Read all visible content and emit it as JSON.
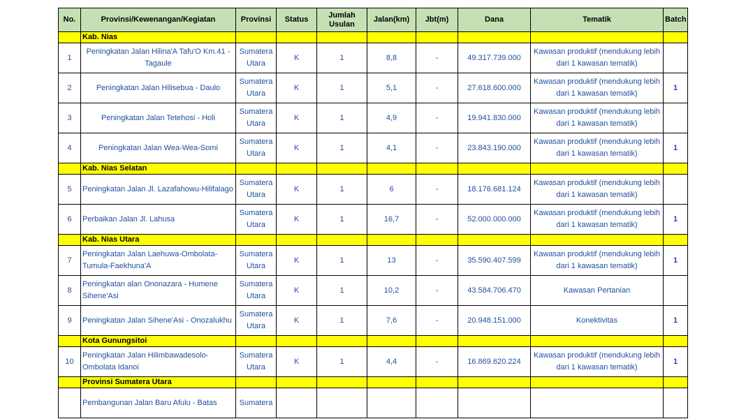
{
  "headers": {
    "no": "No.",
    "kegiatan": "Provinsi/Kewenangan/Kegiatan",
    "provinsi": "Provinsi",
    "status": "Status",
    "jumlah_usulan": "Jumlah Usulan",
    "jalan": "Jalan(km)",
    "jbt": "Jbt(m)",
    "dana": "Dana",
    "tematik": "Tematik",
    "batch": "Batch"
  },
  "groups": [
    {
      "label": "Kab. Nias",
      "rows": [
        {
          "no": "1",
          "kegiatan": "Peningkatan Jalan Hilina'A Tafu'O Km.41 - Tagaule",
          "align": "c",
          "provinsi": "Sumatera Utara",
          "status": "K",
          "usulan": "1",
          "jalan": "8,8",
          "jbt": "-",
          "dana": "49.317.739.000",
          "tematik": "Kawasan produktif (mendukung lebih dari 1 kawasan tematik)",
          "batch": ""
        },
        {
          "no": "2",
          "kegiatan": "Peningkatan Jalan Hilisebua - Daulo",
          "align": "c",
          "provinsi": "Sumatera Utara",
          "status": "K",
          "usulan": "1",
          "jalan": "5,1",
          "jbt": "-",
          "dana": "27.618.600.000",
          "tematik": "Kawasan produktif (mendukung lebih dari 1 kawasan tematik)",
          "batch": "1"
        },
        {
          "no": "3",
          "kegiatan": "Peningkatan Jalan Tetehosi - Holi",
          "align": "c",
          "provinsi": "Sumatera Utara",
          "status": "K",
          "usulan": "1",
          "jalan": "4,9",
          "jbt": "-",
          "dana": "19.941.830.000",
          "tematik": "Kawasan produktif (mendukung lebih dari 1 kawasan tematik)",
          "batch": ""
        },
        {
          "no": "4",
          "kegiatan": "Peningkatan Jalan Wea-Wea-Somi",
          "align": "c",
          "provinsi": "Sumatera Utara",
          "status": "K",
          "usulan": "1",
          "jalan": "4,1",
          "jbt": "-",
          "dana": "23.843.190.000",
          "tematik": "Kawasan produktif (mendukung lebih dari 1 kawasan tematik)",
          "batch": "1"
        }
      ]
    },
    {
      "label": "Kab. Nias Selatan",
      "rows": [
        {
          "no": "5",
          "kegiatan": "Peningkatan Jalan Jl. Lazafahowu-Hilifalago",
          "align": "l",
          "provinsi": "Sumatera Utara",
          "status": "K",
          "usulan": "1",
          "jalan": "6",
          "jbt": "-",
          "dana": "18.176.681.124",
          "tematik": "Kawasan produktif (mendukung lebih dari 1 kawasan tematik)",
          "batch": ""
        },
        {
          "no": "6",
          "kegiatan": "Perbaikan Jalan Jl. Lahusa",
          "align": "l",
          "provinsi": "Sumatera Utara",
          "status": "K",
          "usulan": "1",
          "jalan": "16,7",
          "jbt": "-",
          "dana": "52.000.000.000",
          "tematik": "Kawasan produktif (mendukung lebih dari 1 kawasan tematik)",
          "batch": "1"
        }
      ]
    },
    {
      "label": "Kab. Nias Utara",
      "rows": [
        {
          "no": "7",
          "kegiatan": "Peningkatan Jalan Laehuwa-Ombolata-Tumula-Faekhuna'A",
          "align": "l",
          "provinsi": "Sumatera Utara",
          "status": "K",
          "usulan": "1",
          "jalan": "13",
          "jbt": "-",
          "dana": "35.590.407.599",
          "tematik": "Kawasan produktif (mendukung lebih dari 1 kawasan tematik)",
          "batch": "1"
        },
        {
          "no": "8",
          "kegiatan": "Peningkatan alan Ononazara - Humene Sihene'Asi",
          "align": "l",
          "provinsi": "Sumatera Utara",
          "status": "K",
          "usulan": "1",
          "jalan": "10,2",
          "jbt": "-",
          "dana": "43.584.706.470",
          "tematik": "Kawasan Pertanian",
          "batch": ""
        },
        {
          "no": "9",
          "kegiatan": "Peningkatan Jalan Sihene'Asi - Onozalukhu",
          "align": "l",
          "provinsi": "Sumatera Utara",
          "status": "K",
          "usulan": "1",
          "jalan": "7,6",
          "jbt": "-",
          "dana": "20.948.151.000",
          "tematik": "Konektivitas",
          "batch": "1"
        }
      ]
    },
    {
      "label": "Kota Gunungsitoi",
      "rows": [
        {
          "no": "10",
          "kegiatan": "Peningkatan Jalan Hilimbawadesolo-Ombolata Idanoi",
          "align": "l",
          "provinsi": "Sumatera Utara",
          "status": "K",
          "usulan": "1",
          "jalan": "4,4",
          "jbt": "-",
          "dana": "16.869.620.224",
          "tematik": "Kawasan produktif (mendukung lebih dari 1 kawasan tematik)",
          "batch": "1"
        }
      ]
    },
    {
      "label": "Provinsi Sumatera Utara",
      "rows": [
        {
          "no": "",
          "kegiatan": "Pembangunan Jalan Baru Afulu - Batas",
          "align": "l",
          "provinsi": "Sumatera",
          "status": "",
          "usulan": "",
          "jalan": "",
          "jbt": "",
          "dana": "",
          "tematik": "",
          "batch": ""
        }
      ]
    }
  ]
}
